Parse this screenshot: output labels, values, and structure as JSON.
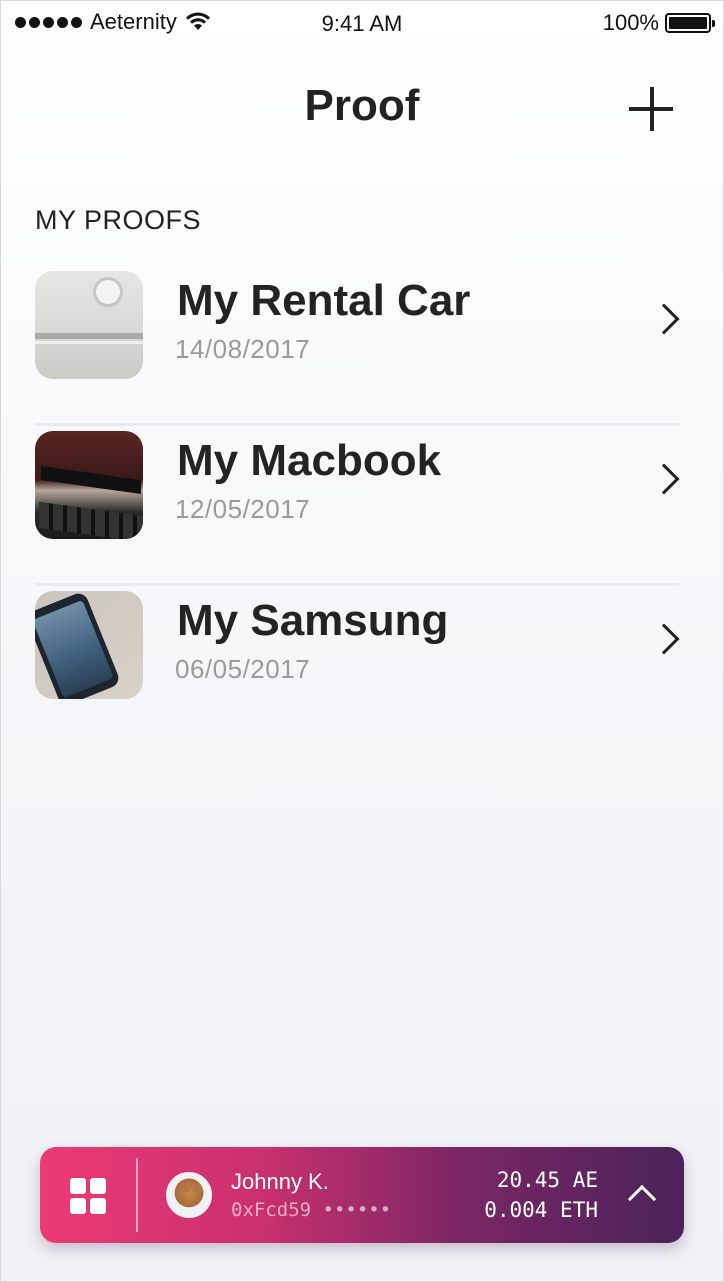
{
  "status_bar": {
    "carrier": "Aeternity",
    "time": "9:41 AM",
    "battery": "100%"
  },
  "nav": {
    "title": "Proof",
    "add_icon": "plus-icon"
  },
  "section": {
    "header": "MY PROOFS"
  },
  "proofs": [
    {
      "title": "My Rental Car",
      "date": "14/08/2017",
      "thumbnail": "car-photo"
    },
    {
      "title": "My Macbook",
      "date": "12/05/2017",
      "thumbnail": "macbook-photo"
    },
    {
      "title": "My Samsung",
      "date": "06/05/2017",
      "thumbnail": "phone-photo"
    }
  ],
  "wallet": {
    "user_name": "Johnny K.",
    "address": "0xFcd59 ••••••",
    "balance_ae": "20.45 AE",
    "balance_eth": "0.004 ETH",
    "gradient_start": "#ec3a74",
    "gradient_end": "#4a235a"
  }
}
